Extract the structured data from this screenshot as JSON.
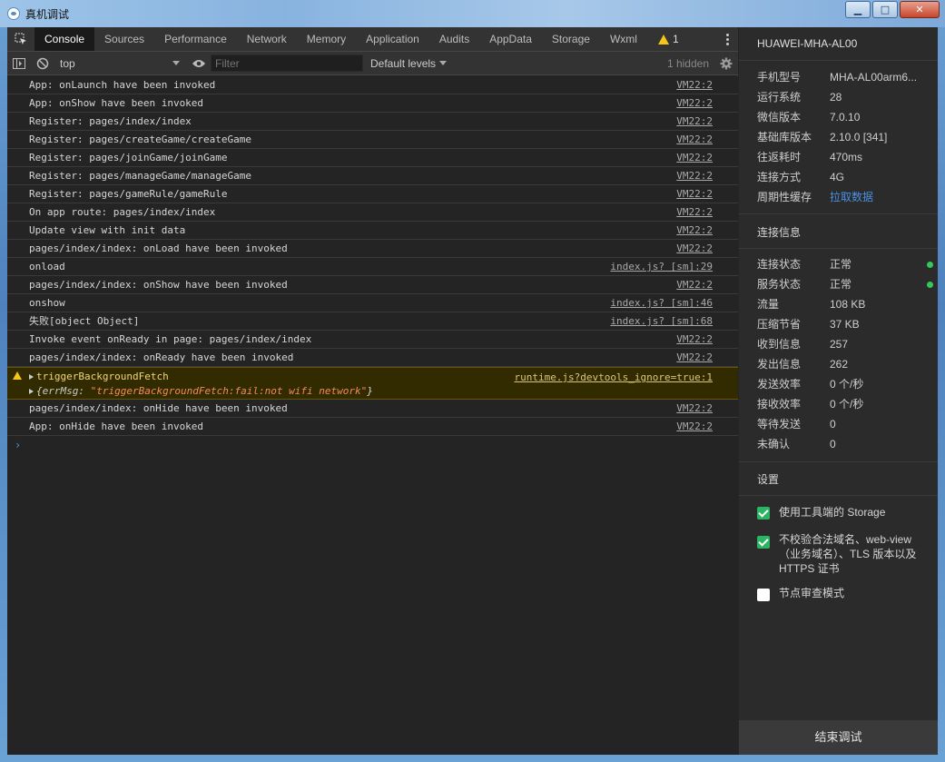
{
  "window": {
    "title": "真机调试",
    "buttons": [
      "minimize",
      "maximize",
      "close"
    ]
  },
  "tabs": [
    {
      "label": "Console",
      "active": true
    },
    {
      "label": "Sources"
    },
    {
      "label": "Performance"
    },
    {
      "label": "Network"
    },
    {
      "label": "Memory"
    },
    {
      "label": "Application"
    },
    {
      "label": "Audits"
    },
    {
      "label": "AppData"
    },
    {
      "label": "Storage"
    },
    {
      "label": "Wxml"
    }
  ],
  "warn_count": "1",
  "toolbar": {
    "context": "top",
    "filter_placeholder": "Filter",
    "levels": "Default levels",
    "hidden": "1 hidden"
  },
  "console": {
    "rows": [
      {
        "text": "App: onLaunch have been invoked",
        "src": "VM22:2"
      },
      {
        "text": "App: onShow have been invoked",
        "src": "VM22:2"
      },
      {
        "text": "Register: pages/index/index",
        "src": "VM22:2"
      },
      {
        "text": "Register: pages/createGame/createGame",
        "src": "VM22:2"
      },
      {
        "text": "Register: pages/joinGame/joinGame",
        "src": "VM22:2"
      },
      {
        "text": "Register: pages/manageGame/manageGame",
        "src": "VM22:2"
      },
      {
        "text": "Register: pages/gameRule/gameRule",
        "src": "VM22:2"
      },
      {
        "text": "On app route: pages/index/index",
        "src": "VM22:2"
      },
      {
        "text": "Update view with init data",
        "src": "VM22:2"
      },
      {
        "text": "pages/index/index: onLoad have been invoked",
        "src": "VM22:2"
      },
      {
        "text": "onload",
        "src": "index.js? [sm]:29"
      },
      {
        "text": "pages/index/index: onShow have been invoked",
        "src": "VM22:2"
      },
      {
        "text": "onshow",
        "src": "index.js? [sm]:46"
      },
      {
        "text": "失败[object Object]",
        "src": "index.js? [sm]:68"
      },
      {
        "text": "Invoke event onReady in page: pages/index/index",
        "src": "VM22:2"
      },
      {
        "text": "pages/index/index: onReady have been invoked",
        "src": "VM22:2"
      }
    ],
    "warning": {
      "title": "triggerBackgroundFetch",
      "src": "runtime.js?devtools_ignore=true:1",
      "obj_prefix": "{",
      "obj_key": "errMsg:",
      "obj_value": "\"triggerBackgroundFetch:fail:not wifi network\"",
      "obj_suffix": "}"
    },
    "rows_after": [
      {
        "text": "pages/index/index: onHide have been invoked",
        "src": "VM22:2"
      },
      {
        "text": "App: onHide have been invoked",
        "src": "VM22:2"
      }
    ],
    "prompt": "›"
  },
  "panel": {
    "device": "HUAWEI-MHA-AL00",
    "info": [
      {
        "k": "手机型号",
        "v": "MHA-AL00arm6..."
      },
      {
        "k": "运行系统",
        "v": "28"
      },
      {
        "k": "微信版本",
        "v": "7.0.10"
      },
      {
        "k": "基础库版本",
        "v": "2.10.0 [341]"
      },
      {
        "k": "往返耗时",
        "v": "470ms"
      },
      {
        "k": "连接方式",
        "v": "4G"
      },
      {
        "k": "周期性缓存",
        "v": "拉取数据",
        "link": true
      }
    ],
    "conn_header": "连接信息",
    "conn": [
      {
        "k": "连接状态",
        "v": "正常",
        "dot": true
      },
      {
        "k": "服务状态",
        "v": "正常",
        "dot": true
      },
      {
        "k": "流量",
        "v": "108 KB"
      },
      {
        "k": "压缩节省",
        "v": "37 KB"
      },
      {
        "k": "收到信息",
        "v": "257"
      },
      {
        "k": "发出信息",
        "v": "262"
      },
      {
        "k": "发送效率",
        "v": "0 个/秒"
      },
      {
        "k": "接收效率",
        "v": "0 个/秒"
      },
      {
        "k": "等待发送",
        "v": "0"
      },
      {
        "k": "未确认",
        "v": "0"
      }
    ],
    "settings_header": "设置",
    "settings": [
      {
        "label": "使用工具端的 Storage",
        "checked": true
      },
      {
        "label": "不校验合法域名、web-view（业务域名）、TLS 版本以及 HTTPS 证书",
        "checked": true
      },
      {
        "label": "节点审查模式",
        "checked": false
      }
    ],
    "end_button": "结束调试"
  }
}
